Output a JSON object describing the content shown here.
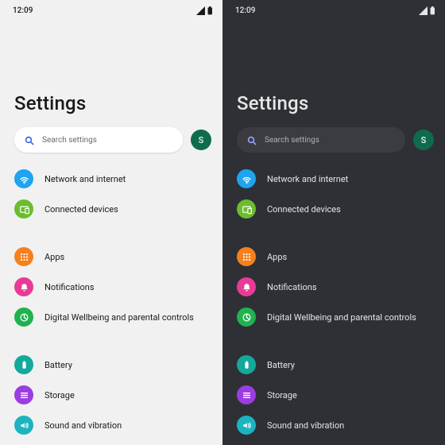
{
  "status": {
    "time": "12:09"
  },
  "title": "Settings",
  "search": {
    "placeholder": "Search settings"
  },
  "avatar": {
    "initial": "S"
  },
  "rows": [
    {
      "label": "Network and internet"
    },
    {
      "label": "Connected devices"
    },
    {
      "label": "Apps"
    },
    {
      "label": "Notifications"
    },
    {
      "label": "Digital Wellbeing and parental controls"
    },
    {
      "label": "Battery"
    },
    {
      "label": "Storage"
    },
    {
      "label": "Sound and vibration"
    }
  ]
}
